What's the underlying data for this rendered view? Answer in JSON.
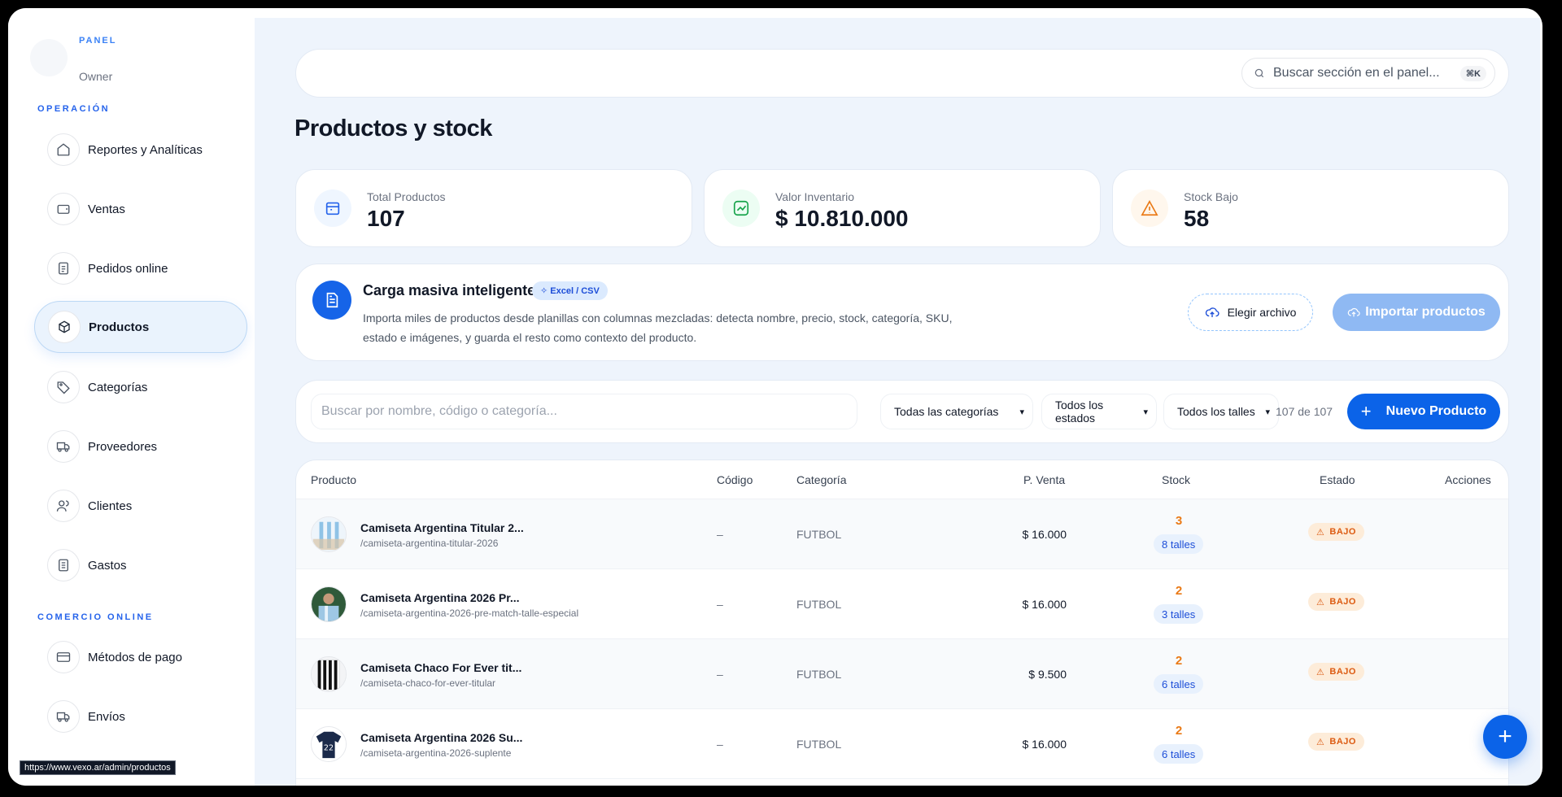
{
  "sidebar": {
    "brand_label": "PANEL",
    "role": "Owner",
    "section_operacion": "OPERACIÓN",
    "section_comercio": "COMERCIO ONLINE",
    "items": [
      {
        "label": "Reportes y Analíticas",
        "icon": "home-icon"
      },
      {
        "label": "Ventas",
        "icon": "wallet-icon"
      },
      {
        "label": "Pedidos online",
        "icon": "document-icon"
      },
      {
        "label": "Productos",
        "icon": "box-icon",
        "active": true
      },
      {
        "label": "Categorías",
        "icon": "tag-icon"
      },
      {
        "label": "Proveedores",
        "icon": "truck-icon"
      },
      {
        "label": "Clientes",
        "icon": "users-icon"
      },
      {
        "label": "Gastos",
        "icon": "receipt-icon"
      },
      {
        "label": "Métodos de pago",
        "icon": "credit-card-icon"
      },
      {
        "label": "Envíos",
        "icon": "truck-icon"
      }
    ]
  },
  "topbar": {
    "search_placeholder": "Buscar sección en el panel...",
    "shortcut": "⌘K"
  },
  "page": {
    "title": "Productos y stock"
  },
  "stats": [
    {
      "label": "Total Productos",
      "value": "107",
      "icon": "box-icon",
      "color": "#3b82f6"
    },
    {
      "label": "Valor Inventario",
      "value": "$ 10.810.000",
      "icon": "trend-up-icon",
      "color": "#16a34a"
    },
    {
      "label": "Stock Bajo",
      "value": "58",
      "icon": "warning-icon",
      "color": "#ea7a16"
    }
  ],
  "bulk": {
    "title": "Carga masiva inteligente",
    "badge": "Excel / CSV",
    "description": "Importa miles de productos desde planillas con columnas mezcladas: detecta nombre, precio, stock, categoría, SKU, estado e imágenes, y guarda el resto como contexto del producto.",
    "choose_file": "Elegir archivo",
    "import_button": "Importar productos"
  },
  "filters": {
    "search_placeholder": "Buscar por nombre, código o categoría...",
    "category": "Todas las categorías",
    "status": "Todos los estados",
    "size": "Todos los talles",
    "count": "107 de 107",
    "new_button": "Nuevo Producto"
  },
  "table": {
    "headers": {
      "product": "Producto",
      "code": "Código",
      "category": "Categoría",
      "price": "P. Venta",
      "stock": "Stock",
      "status": "Estado",
      "actions": "Acciones"
    },
    "rows": [
      {
        "name": "Camiseta Argentina Titular 2...",
        "slug": "/camiseta-argentina-titular-2026",
        "code": "–",
        "category": "FUTBOL",
        "price": "$ 16.000",
        "stock": "3",
        "sizes": "8 talles",
        "status": "BAJO"
      },
      {
        "name": "Camiseta Argentina 2026 Pr...",
        "slug": "/camiseta-argentina-2026-pre-match-talle-especial",
        "code": "–",
        "category": "FUTBOL",
        "price": "$ 16.000",
        "stock": "2",
        "sizes": "3 talles",
        "status": "BAJO"
      },
      {
        "name": "Camiseta Chaco For Ever tit...",
        "slug": "/camiseta-chaco-for-ever-titular",
        "code": "–",
        "category": "FUTBOL",
        "price": "$ 9.500",
        "stock": "2",
        "sizes": "6 talles",
        "status": "BAJO"
      },
      {
        "name": "Camiseta Argentina 2026 Su...",
        "slug": "/camiseta-argentina-2026-suplente",
        "code": "–",
        "category": "FUTBOL",
        "price": "$ 16.000",
        "stock": "2",
        "sizes": "6 talles",
        "status": "BAJO"
      }
    ]
  },
  "status_url": "https://www.vexo.ar/admin/productos"
}
